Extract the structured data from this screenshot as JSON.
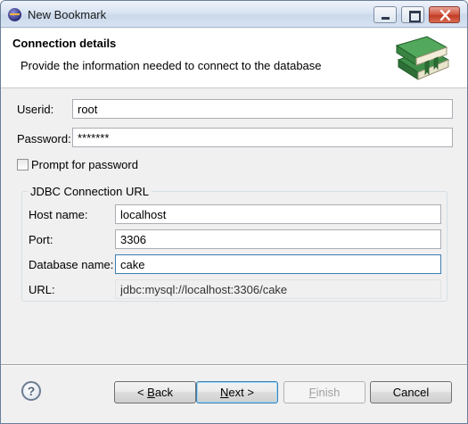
{
  "window": {
    "title": "New Bookmark"
  },
  "banner": {
    "title": "Connection details",
    "description": "Provide the information needed to connect to the database"
  },
  "form": {
    "userid_label": "Userid:",
    "userid_value": "root",
    "password_label": "Password:",
    "password_value": "*******",
    "prompt_label": "Prompt for password",
    "prompt_checked": false
  },
  "jdbc": {
    "group_label": "JDBC Connection URL",
    "host_label": "Host name:",
    "host_value": "localhost",
    "port_label": "Port:",
    "port_value": "3306",
    "db_label": "Database name:",
    "db_value": "cake",
    "url_label": "URL:",
    "url_value": "jdbc:mysql://localhost:3306/cake"
  },
  "buttons": {
    "back_prefix": "< ",
    "back_mnemonic": "B",
    "back_rest": "ack",
    "next_mnemonic": "N",
    "next_rest": "ext >",
    "finish_mnemonic": "F",
    "finish_rest": "inish",
    "cancel": "Cancel"
  },
  "icons": {
    "app": "eclipse-icon",
    "banner": "books-icon",
    "help": "help-icon"
  },
  "colors": {
    "focus_border": "#3c7fb1",
    "banner_bg": "#ffffff",
    "dialog_bg": "#f0f0f0"
  }
}
